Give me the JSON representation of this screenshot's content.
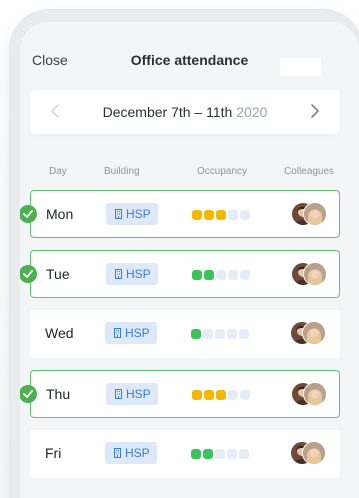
{
  "header": {
    "close_label": "Close",
    "title": "Office attendance"
  },
  "week": {
    "range_label": "December 7th – 11th",
    "year": "2020"
  },
  "columns": {
    "day": "Day",
    "building": "Building",
    "occupancy": "Occupancy",
    "colleagues": "Colleagues"
  },
  "colors": {
    "selected_border": "#5cc46a",
    "check": "#4caf50",
    "occupancy_high": "#f5b800",
    "occupancy_low": "#3cc35a",
    "occupancy_empty": "#e3ecf7",
    "building_bg": "#dde9f8",
    "building_text": "#3b7ae0"
  },
  "days": [
    {
      "day": "Mon",
      "selected": true,
      "building": "HSP",
      "occupancy": 3,
      "occupancy_level": "high"
    },
    {
      "day": "Tue",
      "selected": true,
      "building": "HSP",
      "occupancy": 2,
      "occupancy_level": "low"
    },
    {
      "day": "Wed",
      "selected": false,
      "building": "HSP",
      "occupancy": 1,
      "occupancy_level": "low"
    },
    {
      "day": "Thu",
      "selected": true,
      "building": "HSP",
      "occupancy": 3,
      "occupancy_level": "high"
    },
    {
      "day": "Fri",
      "selected": false,
      "building": "HSP",
      "occupancy": 2,
      "occupancy_level": "low"
    }
  ],
  "occupancy_max": 5,
  "icons": {
    "prev": "chevron-left-icon",
    "next": "chevron-right-icon",
    "check": "checkmark-icon",
    "building": "building-icon"
  }
}
